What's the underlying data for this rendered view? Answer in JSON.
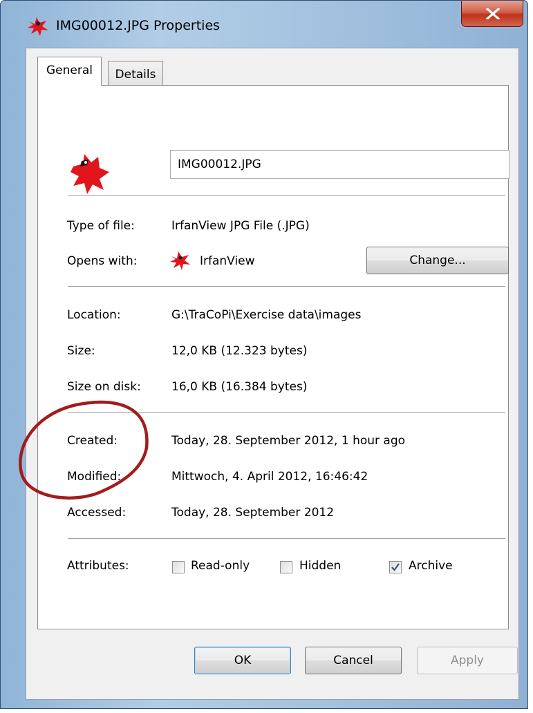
{
  "window": {
    "title": "IMG00012.JPG Properties",
    "close_icon": "close-icon",
    "app_icon": "irfanview-icon"
  },
  "tabs": [
    {
      "label": "General",
      "active": true
    },
    {
      "label": "Details",
      "active": false
    }
  ],
  "general": {
    "filename": "IMG00012.JPG",
    "type_label": "Type of file:",
    "type_value": "IrfanView JPG File (.JPG)",
    "opens_label": "Opens with:",
    "opens_value": "IrfanView",
    "change_label": "Change...",
    "location_label": "Location:",
    "location_value": "G:\\TraCoPi\\Exercise data\\images",
    "size_label": "Size:",
    "size_value": "12,0 KB (12.323 bytes)",
    "size_on_disk_label": "Size on disk:",
    "size_on_disk_value": "16,0 KB (16.384 bytes)",
    "created_label": "Created:",
    "created_value": "Today, 28. September 2012, 1 hour ago",
    "modified_label": "Modified:",
    "modified_value": "Mittwoch, 4. April 2012, 16:46:42",
    "accessed_label": "Accessed:",
    "accessed_value": "Today, 28. September 2012",
    "attributes_label": "Attributes:",
    "attributes": [
      {
        "label": "Read-only",
        "checked": false
      },
      {
        "label": "Hidden",
        "checked": false
      },
      {
        "label": "Archive",
        "checked": true
      }
    ]
  },
  "buttons": {
    "ok": "OK",
    "cancel": "Cancel",
    "apply": "Apply",
    "apply_enabled": false
  },
  "colors": {
    "annotation": "#a31c1c",
    "irfanview_red": "#e1161c",
    "close_button": "#c8452c"
  }
}
